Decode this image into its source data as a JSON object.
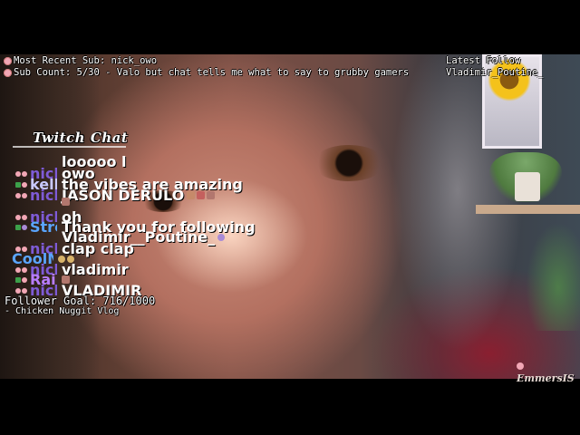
{
  "top_info": {
    "recent_sub": "Most Recent Sub: nick_owo",
    "sub_count": "Sub Count: 5/30 - Valo but chat tells me what to say to grubby gamers"
  },
  "latest_follower": {
    "line1": "Latest Follow",
    "line2": "Vladimir_Poutine_"
  },
  "chat": {
    "title": "Twitch Chat",
    "messages": [
      {
        "user": "",
        "text": "looooo l",
        "color": "#cfcfcf"
      },
      {
        "user": "nick_owo",
        "text": "owo",
        "color": "#7e5bd6"
      },
      {
        "user": "kellogsn...",
        "text": "the vibes are amazing",
        "color": "#c9c9ff"
      },
      {
        "user": "nick_owo",
        "text": "JASON DERULO",
        "color": "#7e5bd6"
      },
      {
        "user": "nick_owo",
        "text": "oh",
        "color": "#7e5bd6"
      },
      {
        "user": "StreamEl...",
        "text": "Thank you for following",
        "color": "#5aa5ff"
      },
      {
        "user": "",
        "text": "Vladimir__Poutine_",
        "color": "#ffffff"
      },
      {
        "user": "nick_owo",
        "text": "clap clap",
        "color": "#7e5bd6"
      },
      {
        "user": "CoolMojoman",
        "text": "",
        "color": "#5aa5ff"
      },
      {
        "user": "nick_owo",
        "text": "vladimir",
        "color": "#7e5bd6"
      },
      {
        "user": "Rainbow...",
        "text": "",
        "color": "#b87dff"
      },
      {
        "user": "nick_owo",
        "text": "VLADIMIR",
        "color": "#7e5bd6"
      }
    ]
  },
  "goal": {
    "title": "Follower Goal: 716/1000",
    "subtitle": "- Chicken Nuggit Vlog"
  },
  "watermark": "EmmersIS"
}
